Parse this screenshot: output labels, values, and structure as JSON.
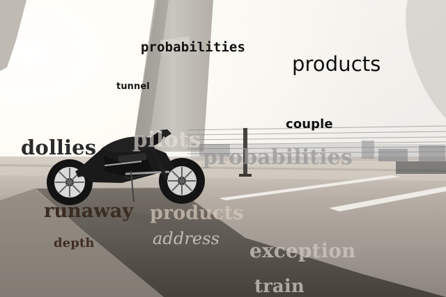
{
  "words": {
    "probabilities_top": "probabilities",
    "products_top": "products",
    "tunnel": "tunnel",
    "couple": "couple",
    "dollies": "dollies",
    "pilots": "pilots",
    "probabilities_mid": "probabilities",
    "runaway": "runaway",
    "products_mid": "products",
    "address": "address",
    "depth": "depth",
    "exception": "exception",
    "train": "train"
  },
  "scene": {
    "subject": "motorcycle",
    "colors": {
      "sky": "#f8f7f2",
      "ground": "#bdb5ac",
      "shadow": "#5c5852",
      "concrete": "#c6c3be",
      "bike": "#1a1a1a"
    }
  }
}
